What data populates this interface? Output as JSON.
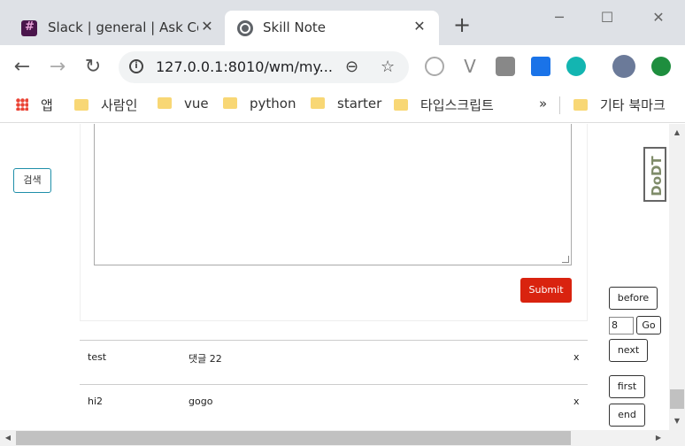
{
  "tabs": [
    {
      "title": "Slack | general | Ask Co",
      "close": "✕"
    },
    {
      "title": "Skill Note",
      "close": "✕"
    }
  ],
  "new_tab": "+",
  "window_controls": {
    "minimize": "─",
    "maximize": "☐",
    "close": "✕"
  },
  "toolbar": {
    "back": "←",
    "forward": "→",
    "reload": "↻",
    "info": "i",
    "url": "127.0.0.1:8010/wm/my...",
    "zoom": "⊖",
    "star": "☆"
  },
  "bookmarks": {
    "apps_label": "앱",
    "items": [
      "사람인",
      "vue",
      "python",
      "starter",
      "타입스크립트"
    ],
    "more": "»",
    "other": "기타 북마크"
  },
  "page": {
    "search_button": "검색",
    "submit_button": "Submit",
    "comments": [
      {
        "author": "test",
        "text": "댓글 22",
        "delete": "x"
      },
      {
        "author": "hi2",
        "text": "gogo",
        "delete": "x"
      }
    ],
    "pagination": {
      "before": "before",
      "page_value": "8",
      "go": "Go",
      "next": "next",
      "first": "first",
      "end": "end"
    },
    "dodt_label": "DoDT"
  },
  "colors": {
    "submit": "#d9230f",
    "search_border": "#1f8fa9"
  }
}
